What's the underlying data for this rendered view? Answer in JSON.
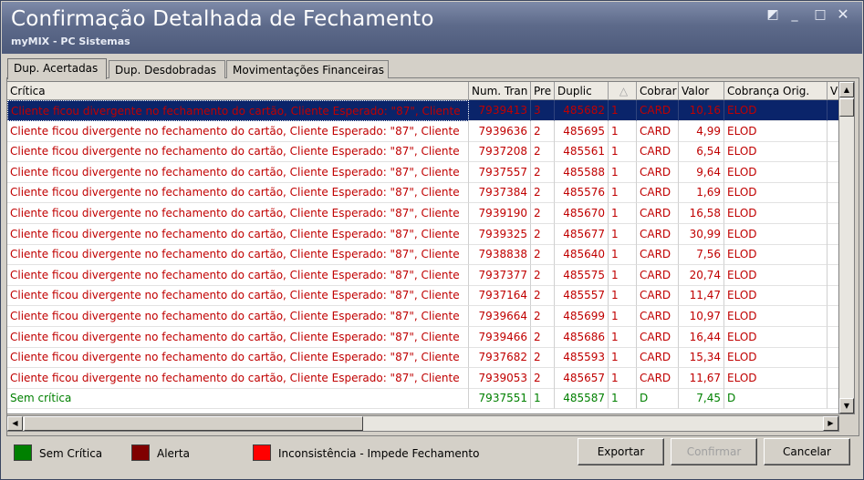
{
  "window": {
    "title": "Confirmação Detalhada de Fechamento",
    "subtitle": "myMIX - PC Sistemas",
    "controls": {
      "restore": "◩",
      "minimize": "_",
      "maximize": "□",
      "close": "✕"
    }
  },
  "tabs": [
    {
      "label": "Dup. Acertadas",
      "active": true
    },
    {
      "label": "Dup. Desdobradas",
      "active": false
    },
    {
      "label": "Movimentações Financeiras",
      "active": false
    }
  ],
  "grid": {
    "columns": [
      "Crítica",
      "Num. Tran",
      "Pre",
      "Duplic",
      "",
      "Cobrar",
      "Valor",
      "Cobrança Orig.",
      "V"
    ],
    "sort_indicator": "△",
    "rows": [
      {
        "critica": "Cliente ficou divergente no fechamento do cartão, Cliente Esperado: \"87\", Cliente",
        "numtran": "7939413",
        "pre": "3",
        "duplic": "485682",
        "flag": "1",
        "cobrar": "CARD",
        "valor": "10,16",
        "cob_orig": "ELOD",
        "status": "alert",
        "selected": true
      },
      {
        "critica": "Cliente ficou divergente no fechamento do cartão, Cliente Esperado: \"87\", Cliente",
        "numtran": "7939636",
        "pre": "2",
        "duplic": "485695",
        "flag": "1",
        "cobrar": "CARD",
        "valor": "4,99",
        "cob_orig": "ELOD",
        "status": "alert"
      },
      {
        "critica": "Cliente ficou divergente no fechamento do cartão, Cliente Esperado: \"87\", Cliente",
        "numtran": "7937208",
        "pre": "2",
        "duplic": "485561",
        "flag": "1",
        "cobrar": "CARD",
        "valor": "6,54",
        "cob_orig": "ELOD",
        "status": "alert"
      },
      {
        "critica": "Cliente ficou divergente no fechamento do cartão, Cliente Esperado: \"87\", Cliente",
        "numtran": "7937557",
        "pre": "2",
        "duplic": "485588",
        "flag": "1",
        "cobrar": "CARD",
        "valor": "9,64",
        "cob_orig": "ELOD",
        "status": "alert"
      },
      {
        "critica": "Cliente ficou divergente no fechamento do cartão, Cliente Esperado: \"87\", Cliente",
        "numtran": "7937384",
        "pre": "2",
        "duplic": "485576",
        "flag": "1",
        "cobrar": "CARD",
        "valor": "1,69",
        "cob_orig": "ELOD",
        "status": "alert"
      },
      {
        "critica": "Cliente ficou divergente no fechamento do cartão, Cliente Esperado: \"87\", Cliente",
        "numtran": "7939190",
        "pre": "2",
        "duplic": "485670",
        "flag": "1",
        "cobrar": "CARD",
        "valor": "16,58",
        "cob_orig": "ELOD",
        "status": "alert"
      },
      {
        "critica": "Cliente ficou divergente no fechamento do cartão, Cliente Esperado: \"87\", Cliente",
        "numtran": "7939325",
        "pre": "2",
        "duplic": "485677",
        "flag": "1",
        "cobrar": "CARD",
        "valor": "30,99",
        "cob_orig": "ELOD",
        "status": "alert"
      },
      {
        "critica": "Cliente ficou divergente no fechamento do cartão, Cliente Esperado: \"87\", Cliente",
        "numtran": "7938838",
        "pre": "2",
        "duplic": "485640",
        "flag": "1",
        "cobrar": "CARD",
        "valor": "7,56",
        "cob_orig": "ELOD",
        "status": "alert"
      },
      {
        "critica": "Cliente ficou divergente no fechamento do cartão, Cliente Esperado: \"87\", Cliente",
        "numtran": "7937377",
        "pre": "2",
        "duplic": "485575",
        "flag": "1",
        "cobrar": "CARD",
        "valor": "20,74",
        "cob_orig": "ELOD",
        "status": "alert"
      },
      {
        "critica": "Cliente ficou divergente no fechamento do cartão, Cliente Esperado: \"87\", Cliente",
        "numtran": "7937164",
        "pre": "2",
        "duplic": "485557",
        "flag": "1",
        "cobrar": "CARD",
        "valor": "11,47",
        "cob_orig": "ELOD",
        "status": "alert"
      },
      {
        "critica": "Cliente ficou divergente no fechamento do cartão, Cliente Esperado: \"87\", Cliente",
        "numtran": "7939664",
        "pre": "2",
        "duplic": "485699",
        "flag": "1",
        "cobrar": "CARD",
        "valor": "10,97",
        "cob_orig": "ELOD",
        "status": "alert"
      },
      {
        "critica": "Cliente ficou divergente no fechamento do cartão, Cliente Esperado: \"87\", Cliente",
        "numtran": "7939466",
        "pre": "2",
        "duplic": "485686",
        "flag": "1",
        "cobrar": "CARD",
        "valor": "16,44",
        "cob_orig": "ELOD",
        "status": "alert"
      },
      {
        "critica": "Cliente ficou divergente no fechamento do cartão, Cliente Esperado: \"87\", Cliente",
        "numtran": "7937682",
        "pre": "2",
        "duplic": "485593",
        "flag": "1",
        "cobrar": "CARD",
        "valor": "15,34",
        "cob_orig": "ELOD",
        "status": "alert"
      },
      {
        "critica": "Cliente ficou divergente no fechamento do cartão, Cliente Esperado: \"87\", Cliente",
        "numtran": "7939053",
        "pre": "2",
        "duplic": "485657",
        "flag": "1",
        "cobrar": "CARD",
        "valor": "11,67",
        "cob_orig": "ELOD",
        "status": "alert"
      },
      {
        "critica": "Sem crítica",
        "numtran": "7937551",
        "pre": "1",
        "duplic": "485587",
        "flag": "1",
        "cobrar": "D",
        "valor": "7,45",
        "cob_orig": "D",
        "status": "ok"
      }
    ]
  },
  "legend": [
    {
      "label": "Sem Crítica",
      "color": "#008000"
    },
    {
      "label": "Alerta",
      "color": "#800000"
    },
    {
      "label": "Inconsistência - Impede Fechamento",
      "color": "#ff0000"
    }
  ],
  "buttons": {
    "export": "Exportar",
    "confirm": "Confirmar",
    "cancel": "Cancelar"
  },
  "colors": {
    "alert_text": "#c00000",
    "ok_text": "#008000",
    "selection": "#0a246a"
  }
}
